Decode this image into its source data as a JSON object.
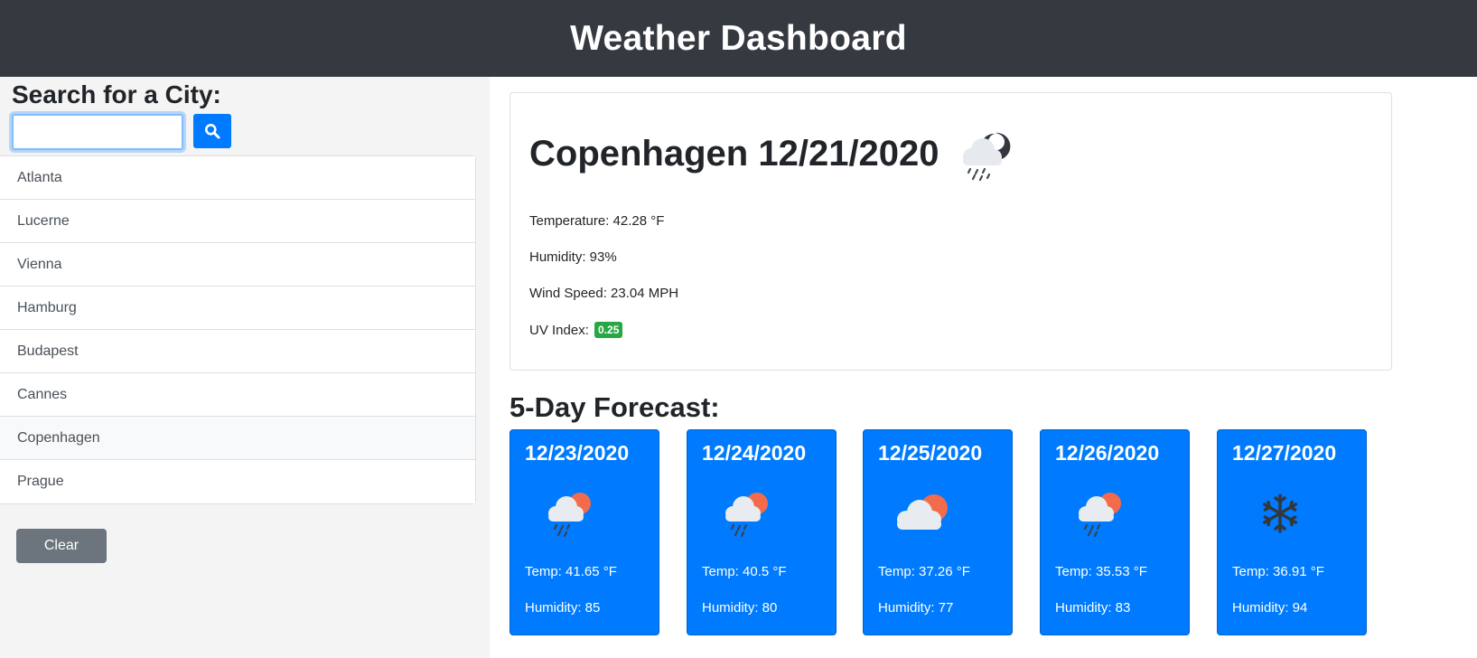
{
  "header": {
    "title": "Weather Dashboard"
  },
  "search": {
    "title": "Search for a City:",
    "value": "",
    "placeholder": "",
    "button_icon": "search-icon"
  },
  "cities": [
    "Atlanta",
    "Lucerne",
    "Vienna",
    "Hamburg",
    "Budapest",
    "Cannes",
    "Copenhagen",
    "Prague"
  ],
  "active_city": "Copenhagen",
  "clear_label": "Clear",
  "current": {
    "title": "Copenhagen 12/21/2020",
    "icon": "night-rain-icon",
    "temperature": "Temperature: 42.28 °F",
    "humidity": "Humidity: 93%",
    "wind": "Wind Speed: 23.04 MPH",
    "uv_label": "UV Index:",
    "uv_value": "0.25",
    "uv_color": "#28a745"
  },
  "forecast": {
    "title": "5-Day Forecast:",
    "days": [
      {
        "date": "12/23/2020",
        "icon": "rain-sun-icon",
        "temp": "Temp: 41.65 °F",
        "humidity": "Humidity: 85"
      },
      {
        "date": "12/24/2020",
        "icon": "rain-sun-icon",
        "temp": "Temp: 40.5 °F",
        "humidity": "Humidity: 80"
      },
      {
        "date": "12/25/2020",
        "icon": "cloud-sun-icon",
        "temp": "Temp: 37.26 °F",
        "humidity": "Humidity: 77"
      },
      {
        "date": "12/26/2020",
        "icon": "rain-sun-icon",
        "temp": "Temp: 35.53 °F",
        "humidity": "Humidity: 83"
      },
      {
        "date": "12/27/2020",
        "icon": "snowflake-icon",
        "temp": "Temp: 36.91 °F",
        "humidity": "Humidity: 94"
      }
    ]
  },
  "colors": {
    "header_bg": "#343a40",
    "primary": "#007bff",
    "secondary": "#6c757d",
    "success": "#28a745"
  }
}
